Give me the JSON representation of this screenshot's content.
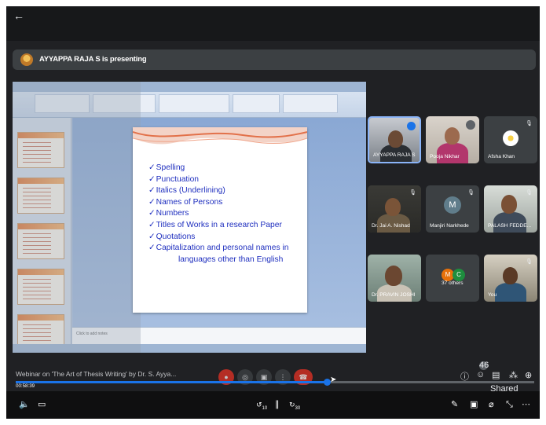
{
  "banner": {
    "presenting_text": "AYYAPPA RAJA S is presenting"
  },
  "slide": {
    "bullets": [
      "Spelling",
      "Punctuation",
      "Italics (Underlining)",
      "Names of Persons",
      "Numbers",
      "Titles of Works in a research Paper",
      "Quotations",
      "Capitalization and personal names in"
    ],
    "continuation": "languages other than English",
    "notes_placeholder": "Click to add notes"
  },
  "participants": [
    {
      "name": "AYYAPPA RAJA S",
      "state": "speaking"
    },
    {
      "name": "Pooja Nikhar",
      "state": "muted"
    },
    {
      "name": "Afsha Khan",
      "state": "muted"
    },
    {
      "name": "Dr. Jai A. Nishad",
      "state": "muted"
    },
    {
      "name": "Manjiri Narkhede",
      "initial": "M",
      "state": "muted"
    },
    {
      "name": "PALASH FEDDE...",
      "state": "muted"
    },
    {
      "name": "Dr. PRAVIN JOSHI",
      "state": "muted"
    },
    {
      "name": "37 others",
      "initials": [
        "M",
        "C"
      ]
    },
    {
      "name": "You",
      "state": "muted"
    }
  ],
  "video": {
    "title": "Webinar on 'The Art of Thesis Writing' by Dr. S. Ayya...",
    "elapsed": "00:58:39",
    "progress_fraction": 0.6,
    "participant_count": "46",
    "shared_label": "Shared"
  },
  "player": {
    "volume_icon": "volume-icon",
    "caption_icon": "caption-icon",
    "rewind_label": "10",
    "forward_label": "30"
  },
  "colors": {
    "meet_bg": "#202124",
    "accent": "#1a73e8",
    "end_call": "#d93025",
    "slide_text": "#1f2fbf"
  }
}
